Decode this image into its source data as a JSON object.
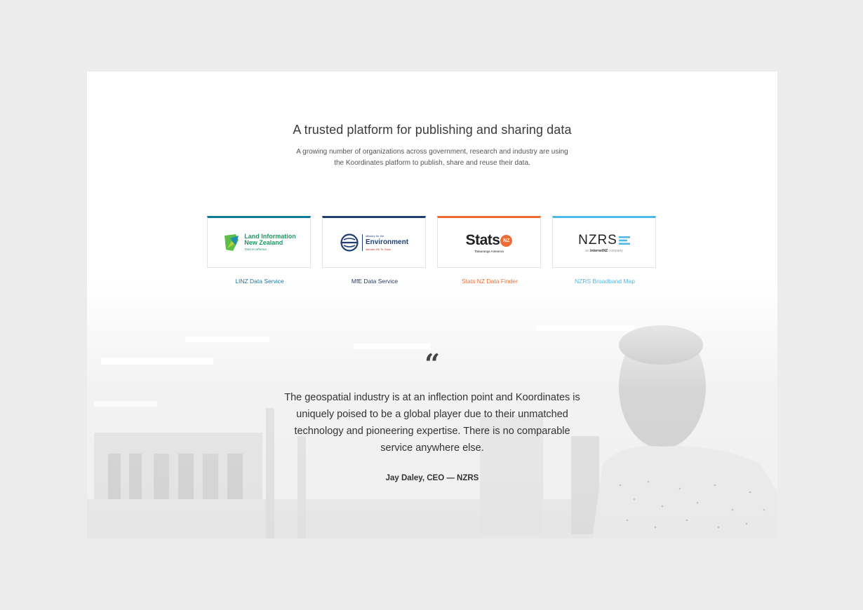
{
  "section": {
    "title": "A trusted platform for publishing and sharing data",
    "description_line1": "A growing number of organizations across government, research and industry are using",
    "description_line2": "the Koordinates platform to publish, share and reuse their data."
  },
  "partners": [
    {
      "link_label": "LINZ Data Service",
      "accent_color": "#0b7a9b",
      "link_color": "#1677a0",
      "logo": {
        "line1": "Land Information",
        "line2": "New Zealand",
        "tagline": "Toitū te whenua"
      }
    },
    {
      "link_label": "MfE Data Service",
      "accent_color": "#1f3f73",
      "link_color": "#233c6a",
      "logo": {
        "small_text": "Ministry for the",
        "main_text": "Environment",
        "tagline": "Manatū Mō Te Taiao"
      }
    },
    {
      "link_label": "Stats NZ Data Finder",
      "accent_color": "#ee6b34",
      "link_color": "#ee6b34",
      "logo": {
        "main_text": "Stats",
        "badge": "NZ",
        "tagline": "Tatauranga Aotearoa"
      }
    },
    {
      "link_label": "NZRS Broadband Map",
      "accent_color": "#4fb9e8",
      "link_color": "#4fb9e8",
      "logo": {
        "main_text": "NZRS",
        "prefix": "an",
        "brand": "InternetNZ",
        "suffix": "company"
      }
    }
  ],
  "testimonial": {
    "quote_mark": "“",
    "quote": "The geospatial industry is at an inflection point and Koordinates is uniquely poised to be a global player due to their unmatched technology and pioneering expertise. There is no comparable service anywhere else.",
    "author": "Jay Daley, CEO — NZRS"
  }
}
